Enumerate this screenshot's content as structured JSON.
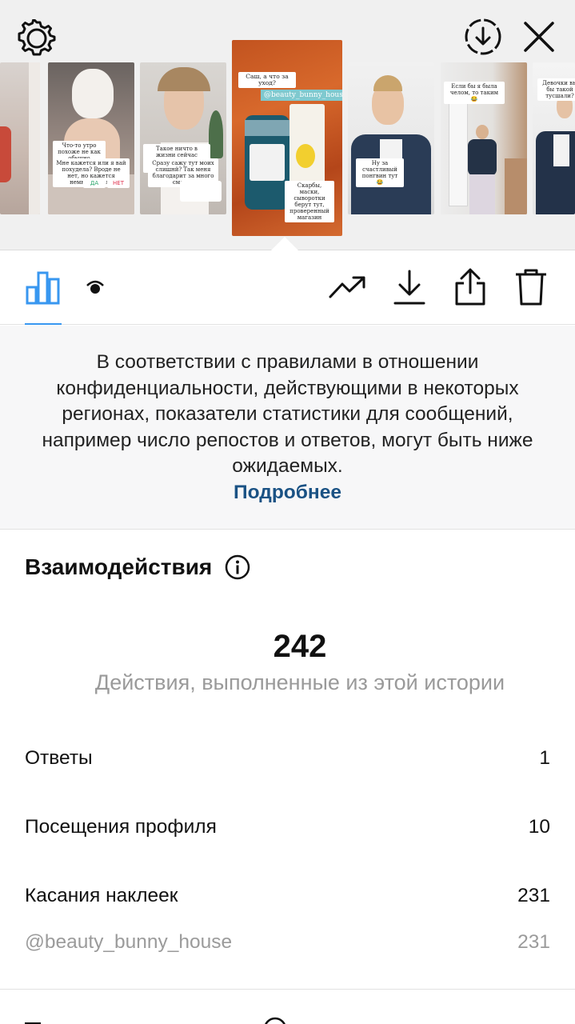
{
  "header": {
    "settings_icon": "gear-icon",
    "download_icon": "circle-download-icon",
    "close_icon": "close-icon"
  },
  "stories": [
    {
      "captions": []
    },
    {
      "captions": [
        "Что-то утро похоже не как обычно",
        "Мне кажется или я вай похудела? Вроде не нет, но кажется немного стала",
        "ДА",
        "НЕТ"
      ]
    },
    {
      "captions": [
        "Такое ничто в жизни сейчас грусть, давайте почти ажимся",
        "Сразу сажу тут моих слишнй? Так меня благодарит за много сметно"
      ]
    },
    {
      "captions": [
        "Саш, а что за уход?",
        "@beauty_bunny_house",
        "Скарбы, маски, сыворотки берут тут, проверенный магазин"
      ]
    },
    {
      "captions": [
        "Ну за счастливый понгвин тут 😂"
      ]
    },
    {
      "captions": [
        "Если бы я была челом, то таким 😂"
      ]
    },
    {
      "captions": [
        "Девочки вы бы такой тусшали?"
      ]
    }
  ],
  "toolbar": {
    "insights_icon": "bar-chart-icon",
    "viewers_icon": "eye-icon",
    "promote_icon": "trending-up-icon",
    "save_icon": "download-icon",
    "share_icon": "share-icon",
    "delete_icon": "trash-icon"
  },
  "notice": {
    "text": "В соответствии с правилами в отношении конфиденциальности, действующими в некоторых регионах, показатели статистики для сообщений, например число репостов и ответов, могут быть ниже ожидаемых.",
    "link": "Подробнее"
  },
  "interactions": {
    "title": "Взаимодействия",
    "info_icon": "info-icon",
    "total": "242",
    "total_label": "Действия, выполненные из этой истории",
    "rows": [
      {
        "label": "Ответы",
        "value": "1"
      },
      {
        "label": "Посещения профиля",
        "value": "10"
      },
      {
        "label": "Касания наклеек",
        "value": "231"
      },
      {
        "label": "@beauty_bunny_house",
        "value": "231"
      }
    ]
  },
  "colors": {
    "accent": "#3897f0",
    "link": "#1a5284",
    "muted": "#9b9b9b"
  }
}
